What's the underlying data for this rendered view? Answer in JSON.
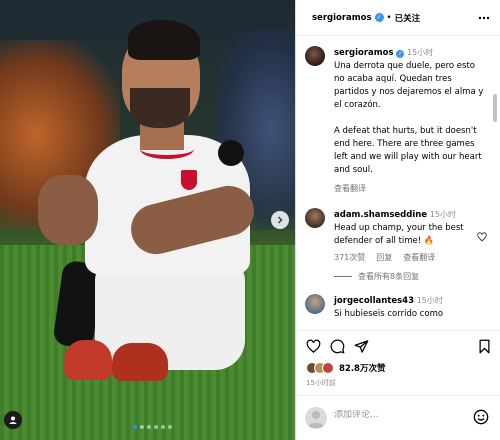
{
  "post": {
    "author": "sergioramos",
    "follow_status": "已关注",
    "separator": "•",
    "caption_time": "15小时",
    "caption_es": "Una derrota que duele, pero esto no acaba aquí. Quedan tres partidos y nos dejaremos el alma y el corazón.",
    "caption_en": "A defeat that hurts, but it doesn't end here. There are three games left and we will play with our heart and soul.",
    "see_translation": "查看翻译",
    "likes": "82.8万次赞",
    "time_ago": "15小时前",
    "add_comment_placeholder": "添加评论..."
  },
  "comments": [
    {
      "username": "adam.shamseddine",
      "time": "15小时",
      "text": "Head up champ, your the best defender of all time! 🔥",
      "likes": "371次赞",
      "reply_label": "回复",
      "translate_label": "查看翻译",
      "replies_label": "查看所有8条回复"
    },
    {
      "username": "jorgecollantes43",
      "time": "15小时",
      "text": "Si hubieseis corrido como"
    }
  ],
  "icons": {
    "verified": "verified-badge-icon",
    "more": "more-options-icon",
    "like": "heart-icon",
    "comment": "comment-icon",
    "share": "send-icon",
    "save": "bookmark-icon",
    "emoji": "emoji-icon",
    "next": "chevron-right-icon",
    "tags": "user-tag-icon"
  },
  "carousel": {
    "slides": 6,
    "active": 1
  },
  "colors": {
    "verified": "#3897f0",
    "link_blue": "#2f8df5",
    "muted": "#8e8e8e"
  }
}
